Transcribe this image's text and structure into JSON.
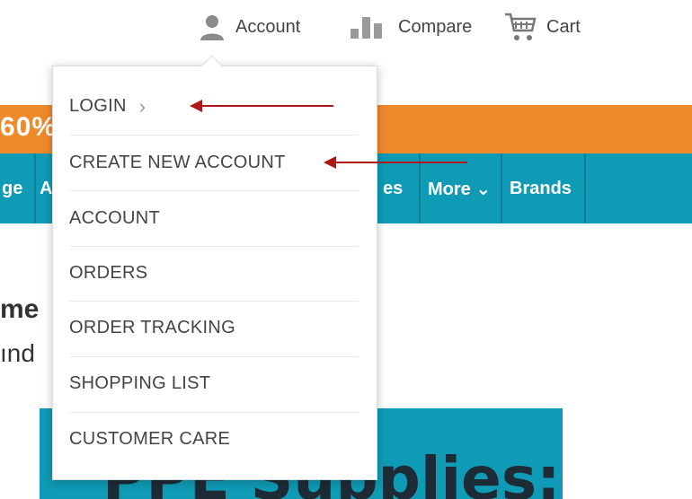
{
  "header": {
    "account_label": "Account",
    "compare_label": "Compare",
    "cart_label": "Cart"
  },
  "promo": {
    "text": "60%"
  },
  "nav": {
    "items": [
      {
        "label": "ge"
      },
      {
        "label": "A"
      },
      {
        "label": "es"
      },
      {
        "label": "More ⌄"
      },
      {
        "label": "Brands"
      }
    ]
  },
  "page": {
    "heading_fragment": "me",
    "sub_fragment": "ınd",
    "banner_text": "PPE Supplies:"
  },
  "account_menu": {
    "items": [
      {
        "label": "LOGIN"
      },
      {
        "label": "CREATE NEW ACCOUNT"
      },
      {
        "label": "ACCOUNT"
      },
      {
        "label": "ORDERS"
      },
      {
        "label": "ORDER TRACKING"
      },
      {
        "label": "SHOPPING LIST"
      },
      {
        "label": "CUSTOMER CARE"
      }
    ],
    "login_chevron": "›"
  },
  "icons": {
    "account": "user-icon",
    "compare": "bar-chart-icon",
    "cart": "cart-icon"
  },
  "colors": {
    "promo": "#ee8a2a",
    "nav": "#0f9bb5",
    "annotation_arrow": "#b01818"
  }
}
